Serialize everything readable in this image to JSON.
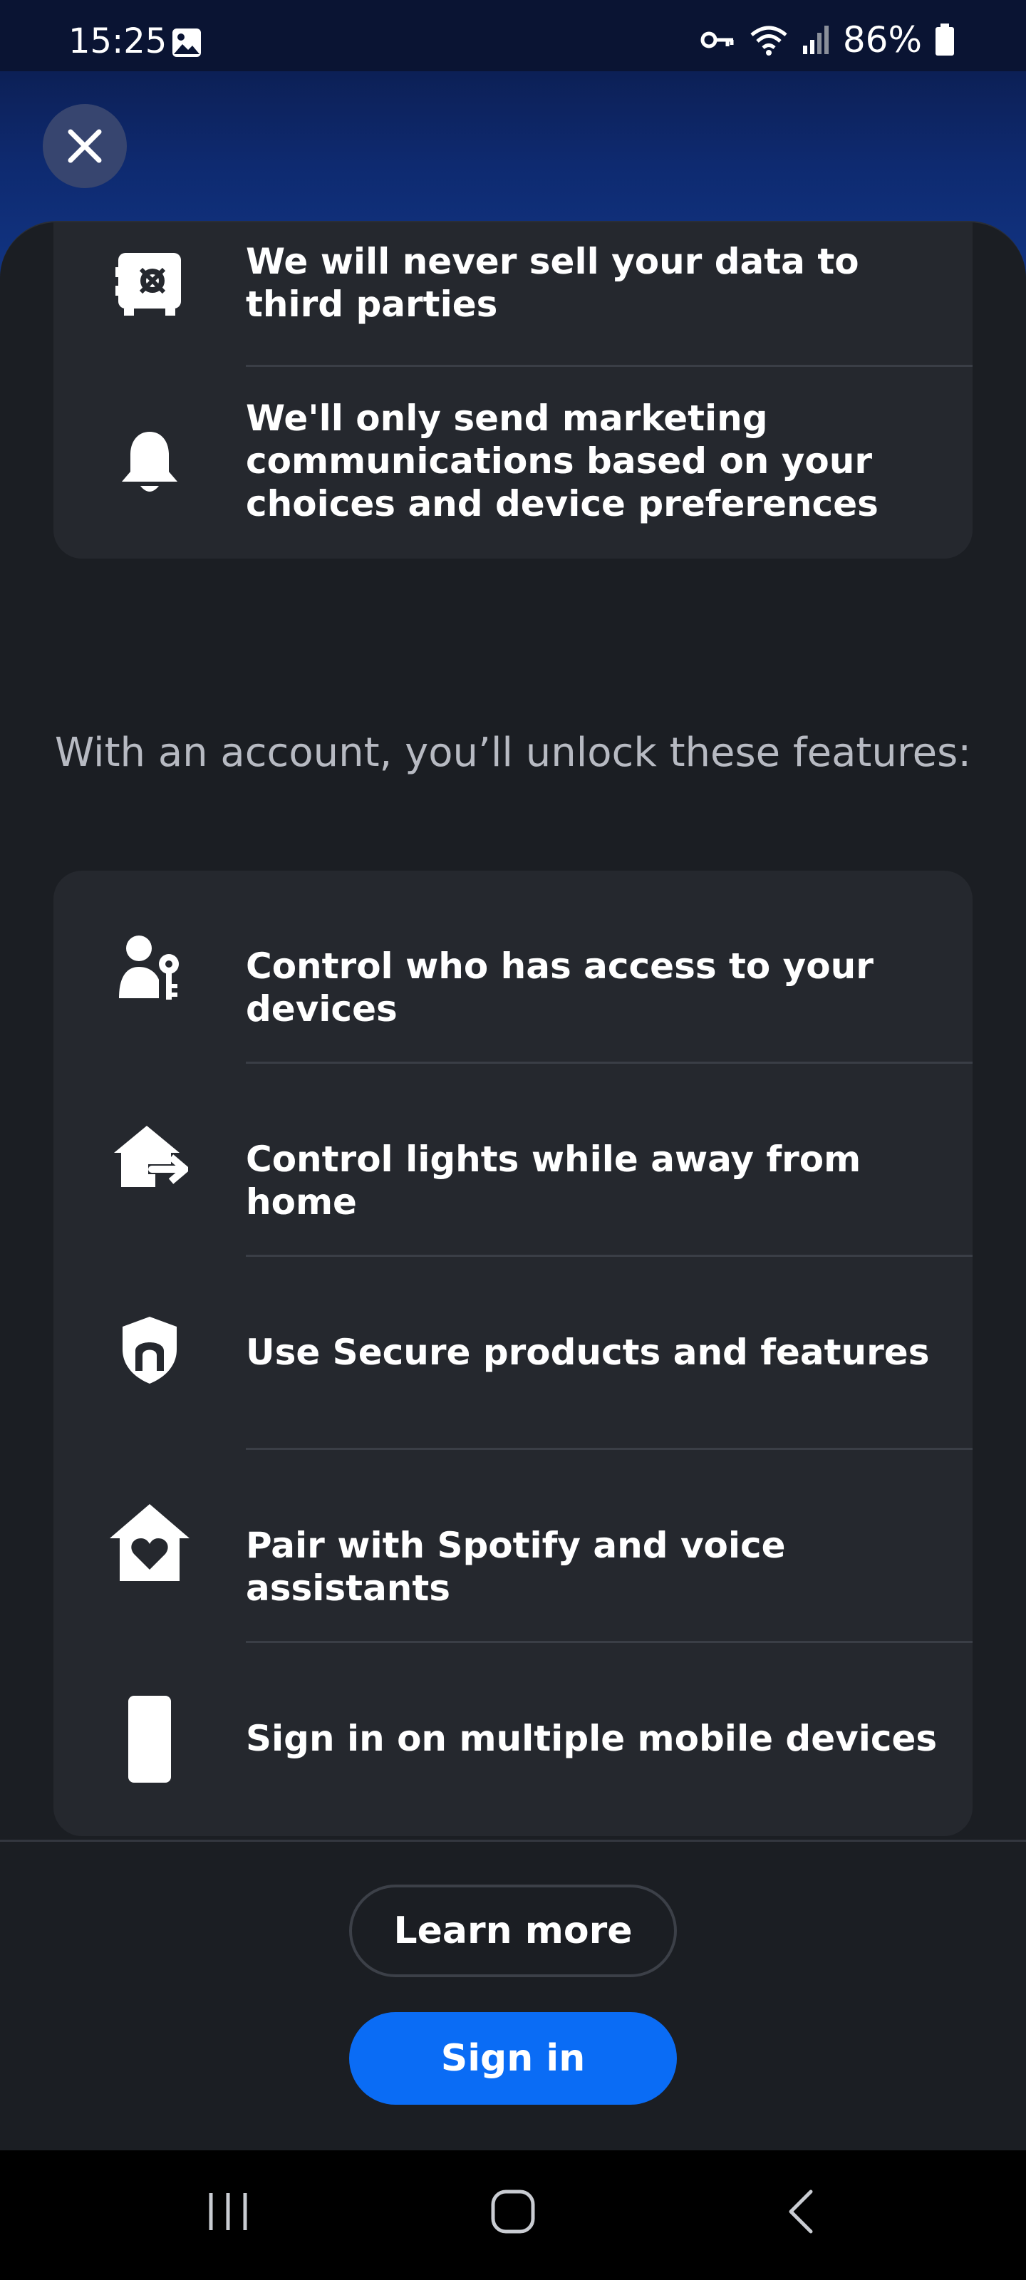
{
  "status_bar": {
    "time": "15:25",
    "battery": "86%"
  },
  "privacy_card": {
    "items": [
      {
        "icon": "safe-icon",
        "text": "We will never sell your data to third parties"
      },
      {
        "icon": "bell-icon",
        "text": "We'll only send marketing communications based on your choices and device preferences"
      }
    ]
  },
  "features_heading": "With an account, you’ll unlock these features:",
  "features": [
    {
      "icon": "user-key-icon",
      "text": "Control who has access to your devices"
    },
    {
      "icon": "house-away-icon",
      "text": "Control lights while away from home"
    },
    {
      "icon": "shield-icon",
      "text": "Use Secure products and features"
    },
    {
      "icon": "house-heart-icon",
      "text": "Pair with Spotify and voice assistants"
    },
    {
      "icon": "phone-icon",
      "text": "Sign in on multiple mobile devices"
    }
  ],
  "buttons": {
    "learn_more": "Learn more",
    "sign_in": "Sign in"
  },
  "colors": {
    "primary": "#0a6cf5",
    "card": "#25282e",
    "background": "#1b1e23"
  }
}
